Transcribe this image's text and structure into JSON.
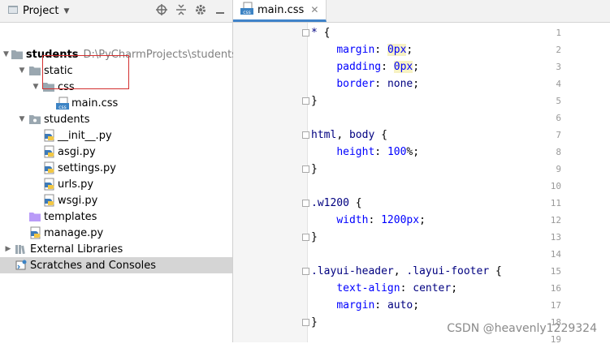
{
  "project_panel": {
    "title": "Project",
    "tree": [
      {
        "label": "students",
        "path": "D:\\PyCharmProjects\\students",
        "bold": true,
        "icon": "folder-icon",
        "arrow": "▼",
        "indent": 0
      },
      {
        "label": "static",
        "icon": "folder-icon",
        "arrow": "▼",
        "indent": 1
      },
      {
        "label": "css",
        "icon": "folder-icon",
        "arrow": "▼",
        "indent": 2
      },
      {
        "label": "main.css",
        "icon": "css-file-icon",
        "arrow": "",
        "indent": 3
      },
      {
        "label": "students",
        "icon": "package-folder-icon",
        "arrow": "▼",
        "indent": 1
      },
      {
        "label": "__init__.py",
        "icon": "python-file-icon",
        "arrow": "",
        "indent": 2
      },
      {
        "label": "asgi.py",
        "icon": "python-file-icon",
        "arrow": "",
        "indent": 2
      },
      {
        "label": "settings.py",
        "icon": "python-file-icon",
        "arrow": "",
        "indent": 2
      },
      {
        "label": "urls.py",
        "icon": "python-file-icon",
        "arrow": "",
        "indent": 2
      },
      {
        "label": "wsgi.py",
        "icon": "python-file-icon",
        "arrow": "",
        "indent": 2
      },
      {
        "label": "templates",
        "icon": "template-folder-icon",
        "arrow": "",
        "indent": 1
      },
      {
        "label": "manage.py",
        "icon": "python-file-icon",
        "arrow": "",
        "indent": 1
      },
      {
        "label": "External Libraries",
        "icon": "library-icon",
        "arrow": "▶",
        "indent": 0
      },
      {
        "label": "Scratches and Consoles",
        "icon": "scratches-icon",
        "arrow": "",
        "indent": 0,
        "selected": true
      }
    ]
  },
  "editor": {
    "tab": "main.css",
    "lines": [
      [
        [
          "sel",
          "* "
        ],
        [
          "punc",
          "{"
        ]
      ],
      [
        [
          "ind",
          "    "
        ],
        [
          "prop",
          "margin"
        ],
        [
          "punc",
          ": "
        ],
        [
          "numhl",
          "0"
        ],
        [
          "unithl",
          "px"
        ],
        [
          "punc",
          ";"
        ]
      ],
      [
        [
          "ind",
          "    "
        ],
        [
          "prop",
          "padding"
        ],
        [
          "punc",
          ": "
        ],
        [
          "numhl",
          "0"
        ],
        [
          "unithl",
          "px"
        ],
        [
          "punc",
          ";"
        ]
      ],
      [
        [
          "ind",
          "    "
        ],
        [
          "prop",
          "border"
        ],
        [
          "punc",
          ": "
        ],
        [
          "val",
          "none"
        ],
        [
          "punc",
          ";"
        ]
      ],
      [
        [
          "punc",
          "}"
        ]
      ],
      [],
      [
        [
          "sel",
          "html"
        ],
        [
          "punc",
          ", "
        ],
        [
          "sel",
          "body "
        ],
        [
          "punc",
          "{"
        ]
      ],
      [
        [
          "ind",
          "    "
        ],
        [
          "prop",
          "height"
        ],
        [
          "punc",
          ": "
        ],
        [
          "num",
          "100"
        ],
        [
          "punc",
          "%;"
        ]
      ],
      [
        [
          "punc",
          "}"
        ]
      ],
      [],
      [
        [
          "sel",
          ".w1200 "
        ],
        [
          "punc",
          "{"
        ]
      ],
      [
        [
          "ind",
          "    "
        ],
        [
          "prop",
          "width"
        ],
        [
          "punc",
          ": "
        ],
        [
          "num",
          "1200"
        ],
        [
          "unit",
          "px"
        ],
        [
          "punc",
          ";"
        ]
      ],
      [
        [
          "punc",
          "}"
        ]
      ],
      [],
      [
        [
          "sel",
          ".layui-header"
        ],
        [
          "punc",
          ", "
        ],
        [
          "sel",
          ".layui-footer "
        ],
        [
          "punc",
          "{"
        ]
      ],
      [
        [
          "ind",
          "    "
        ],
        [
          "prop",
          "text-align"
        ],
        [
          "punc",
          ": "
        ],
        [
          "val",
          "center"
        ],
        [
          "punc",
          ";"
        ]
      ],
      [
        [
          "ind",
          "    "
        ],
        [
          "prop",
          "margin"
        ],
        [
          "punc",
          ": "
        ],
        [
          "val",
          "auto"
        ],
        [
          "punc",
          ";"
        ]
      ],
      [
        [
          "punc",
          "}"
        ]
      ],
      []
    ],
    "line_numbers": [
      "1",
      "2",
      "3",
      "4",
      "5",
      "6",
      "7",
      "8",
      "9",
      "10",
      "11",
      "12",
      "13",
      "14",
      "15",
      "16",
      "17",
      "18",
      "19"
    ]
  },
  "watermark": "CSDN @heavenly1229324"
}
